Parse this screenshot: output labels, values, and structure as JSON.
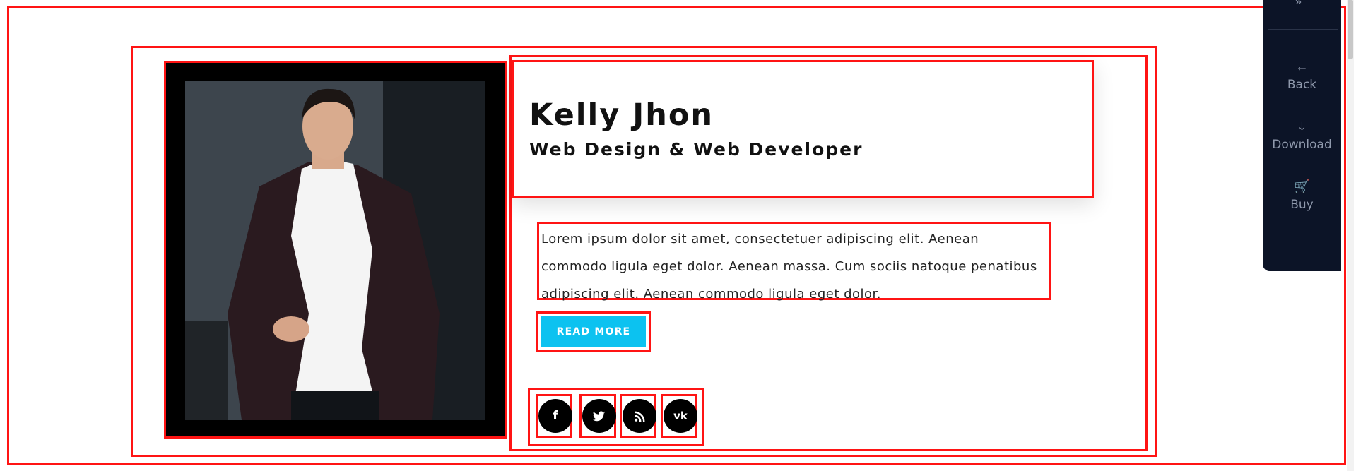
{
  "profile": {
    "name": "Kelly Jhon",
    "role": "Web Design & Web Developer",
    "description": "Lorem ipsum dolor sit amet, consectetuer adipiscing elit. Aenean commodo ligula eget dolor. Aenean massa. Cum sociis natoque penatibus adipiscing elit. Aenean commodo ligula eget dolor.",
    "read_more_label": "READ MORE"
  },
  "social": [
    {
      "name": "facebook-icon",
      "glyph": "f"
    },
    {
      "name": "twitter-icon",
      "glyph": "🐦"
    },
    {
      "name": "rss-icon",
      "glyph": "◝"
    },
    {
      "name": "vk-icon",
      "glyph": "vk"
    }
  ],
  "side_panel": {
    "items": [
      {
        "label": "Back",
        "icon": "arrow-left-icon"
      },
      {
        "label": "Download",
        "icon": "download-icon"
      },
      {
        "label": "Buy",
        "icon": "cart-icon"
      }
    ]
  },
  "colors": {
    "accent": "#0cc2f0",
    "panel": "#0c1427",
    "annotation": "#ff1414"
  }
}
